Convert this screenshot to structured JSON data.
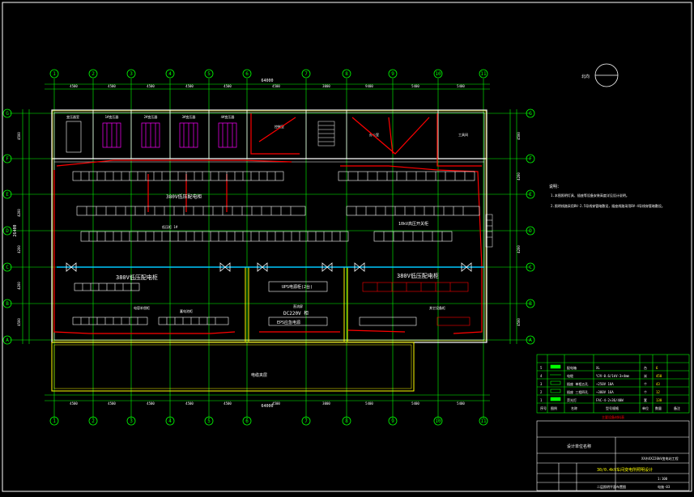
{
  "axis_labels": {
    "columns": [
      "1",
      "2",
      "3",
      "4",
      "5",
      "6",
      "7",
      "8",
      "9",
      "10",
      "11"
    ],
    "rows": [
      "G",
      "F",
      "E",
      "D",
      "C",
      "B",
      "A"
    ]
  },
  "dimensions": {
    "top_total": "64000",
    "top_segments": [
      "4500",
      "4500",
      "4500",
      "4500",
      "4500",
      "4500",
      "3000",
      "9400",
      "5400",
      "5400",
      "5400"
    ],
    "bottom_total": "64000",
    "bottom_segments": [
      "4500",
      "4500",
      "4500",
      "4500",
      "4500",
      "4500",
      "3000",
      "5400",
      "5400",
      "5400"
    ],
    "left_total": "26400",
    "left_segments": [
      "4500",
      "3000",
      "4200",
      "4200",
      "4200",
      "3000",
      "4500"
    ]
  },
  "rooms": {
    "switch_room_label": "变压器室",
    "top_rooms": [
      "1#变压器",
      "2#变压器",
      "3#变压器",
      "4#变压器"
    ],
    "control_room": "控制室",
    "office": "办公室",
    "tool_room": "工具间",
    "basement_label": "电缆夹层"
  },
  "equipment": {
    "row_380v_top": "380V低压配电柜",
    "row_10kv": "10kV高压开关柜",
    "row_380v_left": "380V低压配电柜",
    "row_380v_right": "380V低压配电柜",
    "ups": "UPS电源柜(2台)",
    "dc": "DC220V 柜",
    "eps": "EPS应急电源",
    "capacitor": "电容补偿柜",
    "battery": "蓄电池柜",
    "other": "其它设备柜",
    "feed": "直流屏",
    "group_label": "低压柜 1#"
  },
  "north": {
    "label": "北向"
  },
  "notes": {
    "title": "说明：",
    "lines": [
      "1.本图照明灯具、插座等设备安装高度详见设计说明。",
      "2.照明线路采用BV-2.5导线穿管暗敷设，插座线路采用BV-4导线穿管暗敷设。"
    ]
  },
  "legend": {
    "header": "主要设备材料表",
    "columns": [
      "序号",
      "图例",
      "名称",
      "型号规格",
      "单位",
      "数量",
      "备注"
    ],
    "rows": [
      {
        "no": "5",
        "sym": "",
        "name": "配电箱",
        "spec": "XL",
        "unit": "台",
        "qty": "6"
      },
      {
        "no": "4",
        "sym": "",
        "name": "电缆",
        "spec": "YJV-0.6/1kV-3×4mm",
        "unit": "米",
        "qty": "450"
      },
      {
        "no": "3",
        "sym": "",
        "name": "插座 单相五孔",
        "spec": "~250V 10A",
        "unit": "个",
        "qty": "43"
      },
      {
        "no": "2",
        "sym": "",
        "name": "插座 三相四孔",
        "spec": "~380V 16A",
        "unit": "个",
        "qty": "12"
      },
      {
        "no": "1",
        "sym": "",
        "name": "荧光灯",
        "spec": "FAC-4-2×36/40W",
        "unit": "套",
        "qty": "130"
      }
    ]
  },
  "title_block": {
    "company": "设计单位名称",
    "project": "XX市XX220kV变电站工程",
    "drawing": "30/0.4kV车间变电所照明设计",
    "sheet": "二层照明平面布置图",
    "scale": "1:100",
    "sheet_no": "电施-03"
  },
  "colors": {
    "background": "#000000",
    "grid": "#00ff00",
    "wall": "#ffffff",
    "wire": "#ff0000",
    "bus": "#00c8ff",
    "yellow": "#ffff00",
    "magenta": "#ff00ff"
  }
}
